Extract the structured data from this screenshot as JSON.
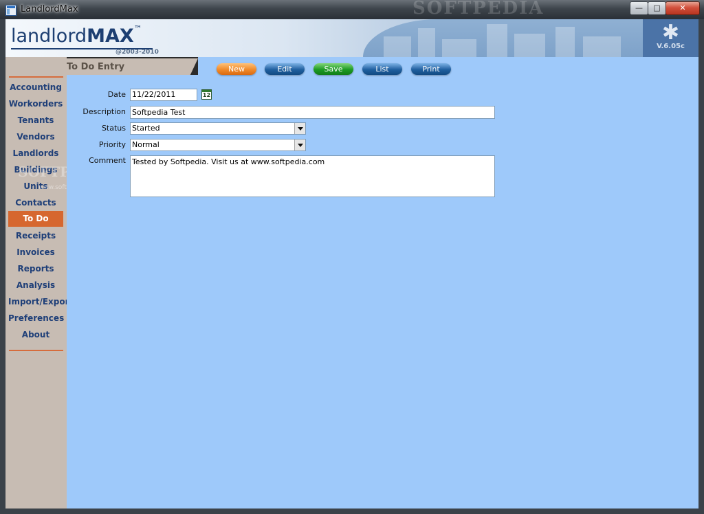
{
  "window": {
    "title": "LandlordMax",
    "ghost_text": "SOFTPEDIA",
    "controls": {
      "minimize": "—",
      "maximize": "□",
      "close": "✕"
    }
  },
  "header": {
    "logo_light": "landlord",
    "logo_bold": "MAX",
    "logo_tm": "™",
    "copyright": "@2003-2010",
    "version_icon": "✱",
    "version": "V.6.05c"
  },
  "page": {
    "title": "To Do Entry"
  },
  "toolbar": {
    "new": "New",
    "edit": "Edit",
    "save": "Save",
    "list": "List",
    "print": "Print"
  },
  "sidebar": {
    "items": [
      "Accounting",
      "Workorders",
      "Tenants",
      "Vendors",
      "Landlords",
      "Buildings",
      "Units",
      "Contacts",
      "To Do",
      "Receipts",
      "Invoices",
      "Reports",
      "Analysis",
      "Import/Export",
      "Preferences",
      "About"
    ],
    "active": "To Do",
    "watermark": "SOFTPEDIA",
    "watermark_url": "www.softpedia.com"
  },
  "form": {
    "date_label": "Date",
    "date_value": "11/22/2011",
    "calendar_text": "12",
    "description_label": "Description",
    "description_value": "Softpedia Test",
    "status_label": "Status",
    "status_value": "Started",
    "priority_label": "Priority",
    "priority_value": "Normal",
    "comment_label": "Comment",
    "comment_value": "Tested by Softpedia. Visit us at www.softpedia.com"
  },
  "colors": {
    "content_bg": "#9ec9fa",
    "sidebar_bg": "#c7bcb3",
    "accent": "#d6672f",
    "nav_text": "#1f3f78"
  }
}
